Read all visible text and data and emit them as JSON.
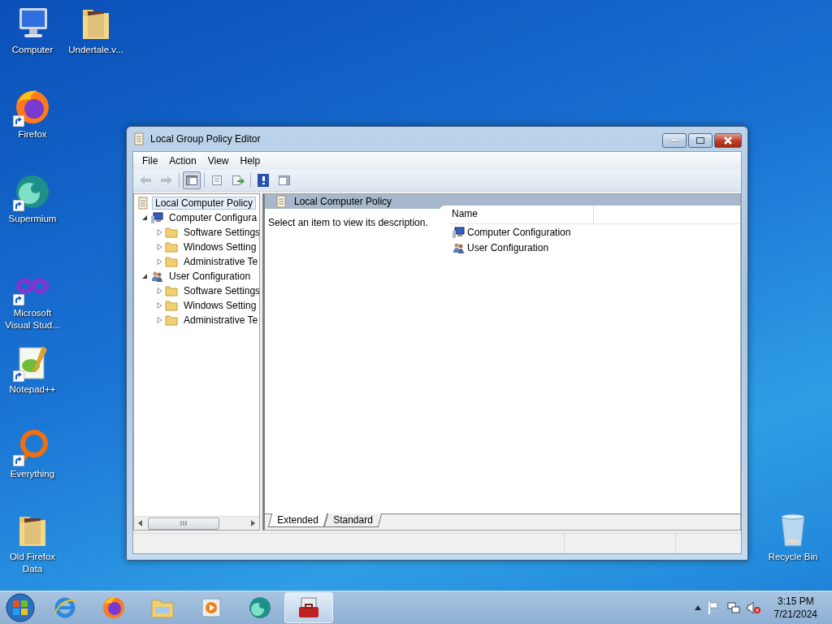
{
  "desktop_icons": [
    {
      "label": "Computer",
      "kind": "computer",
      "shortcut": false
    },
    {
      "label": "Undertale.v...",
      "kind": "folder",
      "shortcut": false
    },
    {
      "label": "Firefox",
      "kind": "firefox",
      "shortcut": true
    },
    {
      "label": "Supermium",
      "kind": "supermium",
      "shortcut": true
    },
    {
      "label": "Microsoft Visual Stud...",
      "kind": "vs",
      "shortcut": true
    },
    {
      "label": "Notepad++",
      "kind": "notepad",
      "shortcut": true
    },
    {
      "label": "Everything",
      "kind": "everything",
      "shortcut": true
    },
    {
      "label": "Old Firefox Data",
      "kind": "folder",
      "shortcut": false
    },
    {
      "label": "Recycle Bin",
      "kind": "bin",
      "shortcut": false
    }
  ],
  "window": {
    "title": "Local Group Policy Editor",
    "menu": [
      "File",
      "Action",
      "View",
      "Help"
    ],
    "tree": [
      {
        "label": "Local Computer Policy",
        "kind": "policy",
        "selected": true,
        "children": [
          {
            "label": "Computer Configura",
            "kind": "computer",
            "selected": false,
            "expanded": true,
            "children": [
              {
                "label": "Software Settings",
                "kind": "folder",
                "selected": false,
                "expanded": false
              },
              {
                "label": "Windows Setting",
                "kind": "folder",
                "selected": false,
                "expanded": false
              },
              {
                "label": "Administrative Te",
                "kind": "folder",
                "selected": false,
                "expanded": false
              }
            ]
          },
          {
            "label": "User Configuration",
            "kind": "user",
            "selected": false,
            "expanded": true,
            "children": [
              {
                "label": "Software Settings",
                "kind": "folder",
                "selected": false,
                "expanded": false
              },
              {
                "label": "Windows Setting",
                "kind": "folder",
                "selected": false,
                "expanded": false
              },
              {
                "label": "Administrative Te",
                "kind": "folder",
                "selected": false,
                "expanded": false
              }
            ]
          }
        ]
      }
    ],
    "content": {
      "header": "Local Computer Policy",
      "description": "Select an item to view its description.",
      "columns": [
        "Name"
      ],
      "rows": [
        {
          "name": "Computer Configuration",
          "kind": "computer"
        },
        {
          "name": "User Configuration",
          "kind": "user"
        }
      ]
    },
    "view_tabs": [
      {
        "label": "Extended",
        "selected": true
      },
      {
        "label": "Standard",
        "selected": false
      }
    ]
  },
  "taskbar": {
    "apps": [
      {
        "kind": "ie",
        "selected": false
      },
      {
        "kind": "firefox",
        "selected": false
      },
      {
        "kind": "explorer",
        "selected": false
      },
      {
        "kind": "media",
        "selected": false
      },
      {
        "kind": "supermium",
        "selected": false
      },
      {
        "kind": "toolbox",
        "selected": true
      }
    ],
    "time": "3:15 PM",
    "date": "7/21/2024"
  }
}
